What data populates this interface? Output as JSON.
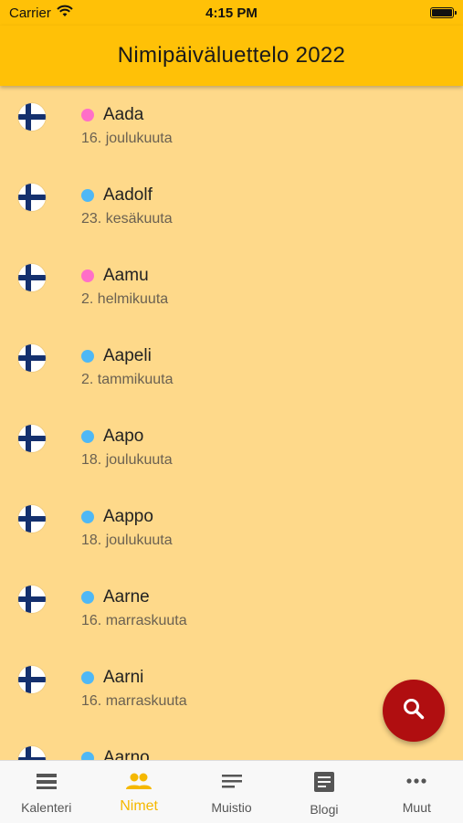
{
  "status": {
    "carrier": "Carrier",
    "time": "4:15 PM"
  },
  "header": {
    "title": "Nimipäiväluettelo 2022"
  },
  "colors": {
    "female": "#FF6FC8",
    "male": "#4FB8F5",
    "accent": "#FFC107",
    "fab": "#B00E10"
  },
  "names": [
    {
      "name": "Aada",
      "date": "16. joulukuuta",
      "gender": "female"
    },
    {
      "name": "Aadolf",
      "date": "23. kesäkuuta",
      "gender": "male"
    },
    {
      "name": "Aamu",
      "date": "2. helmikuuta",
      "gender": "female"
    },
    {
      "name": "Aapeli",
      "date": "2. tammikuuta",
      "gender": "male"
    },
    {
      "name": "Aapo",
      "date": "18. joulukuuta",
      "gender": "male"
    },
    {
      "name": "Aappo",
      "date": "18. joulukuuta",
      "gender": "male"
    },
    {
      "name": "Aarne",
      "date": "16. marraskuuta",
      "gender": "male"
    },
    {
      "name": "Aarni",
      "date": "16. marraskuuta",
      "gender": "male"
    },
    {
      "name": "Aarno",
      "date": "",
      "gender": "male"
    }
  ],
  "fab": {
    "icon": "search-icon"
  },
  "tabs": [
    {
      "label": "Kalenteri",
      "icon": "calendar-list-icon"
    },
    {
      "label": "Nimet",
      "icon": "people-icon",
      "active": true
    },
    {
      "label": "Muistio",
      "icon": "notes-icon"
    },
    {
      "label": "Blogi",
      "icon": "article-icon"
    },
    {
      "label": "Muut",
      "icon": "more-icon"
    }
  ]
}
